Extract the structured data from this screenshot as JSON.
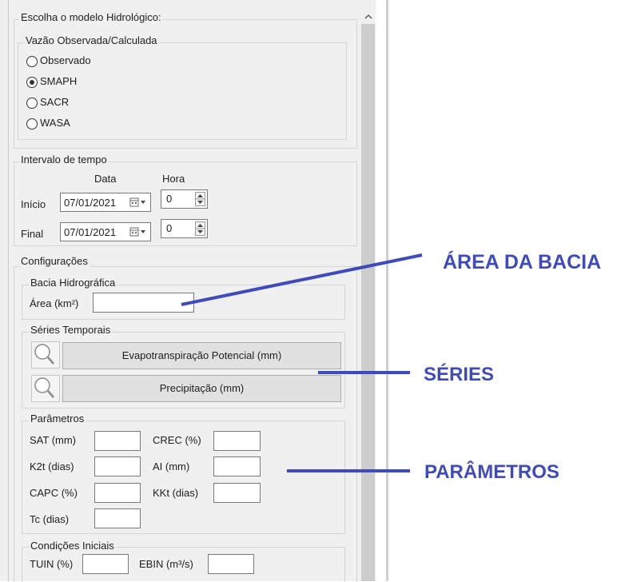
{
  "model_group": {
    "title": "Escolha o modelo Hidrológico:",
    "subgroup_title": "Vazão Observada/Calculada",
    "options": [
      {
        "label": "Observado",
        "selected": false
      },
      {
        "label": "SMAPH",
        "selected": true
      },
      {
        "label": "SACR",
        "selected": false
      },
      {
        "label": "WASA",
        "selected": false
      }
    ]
  },
  "time_group": {
    "title": "Intervalo de tempo",
    "col_date": "Data",
    "col_hour": "Hora",
    "start_label": "Início",
    "start_date": "07/01/2021",
    "start_hour": "0",
    "end_label": "Final",
    "end_date": "07/01/2021",
    "end_hour": "0"
  },
  "config_group": {
    "title": "Configurações",
    "basin": {
      "title": "Bacia Hidrográfica",
      "area_label": "Área (km²)",
      "area_value": ""
    },
    "series": {
      "title": "Séries Temporais",
      "evapo_button": "Evapotranspiração Potencial (mm)",
      "precip_button": "Precipitação (mm)"
    },
    "params": {
      "title": "Parâmetros",
      "sat_label": "SAT (mm)",
      "sat_value": "",
      "crec_label": "CREC (%)",
      "crec_value": "",
      "k2t_label": "K2t (dias)",
      "k2t_value": "",
      "ai_label": "AI (mm)",
      "ai_value": "",
      "capc_label": "CAPC (%)",
      "capc_value": "",
      "kkt_label": "KKt (dias)",
      "kkt_value": "",
      "tc_label": "Tc (dias)",
      "tc_value": ""
    },
    "initial": {
      "title": "Condições Iniciais",
      "tuin_label": "TUIN (%)",
      "tuin_value": "",
      "ebin_label": "EBIN (m³/s)",
      "ebin_value": ""
    }
  },
  "annotations": {
    "area": "ÁREA DA BACIA",
    "series": "SÉRIES",
    "params": "PARÂMETROS",
    "color": "#3f4bbb"
  },
  "icons": [
    "magnifier-icon",
    "calendar-icon",
    "spin-arrows-icon",
    "scroll-up-icon"
  ]
}
